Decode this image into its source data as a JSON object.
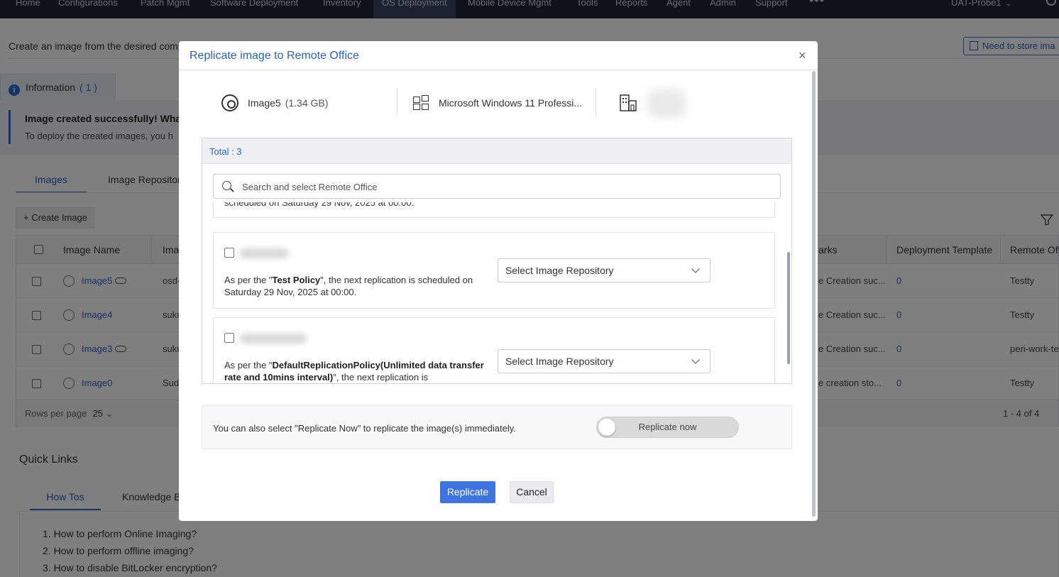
{
  "nav": {
    "items": [
      "Home",
      "Configurations",
      "Patch Mgmt",
      "Software Deployment",
      "Inventory",
      "OS Deployment",
      "Mobile Device Mgmt",
      "Tools",
      "Reports",
      "Agent",
      "Admin",
      "Support"
    ],
    "more": "•••",
    "probe": "UAT-Probe1"
  },
  "page": {
    "description": "Create an image from the desired comp",
    "need_store": "Need to store ima",
    "info_tab": {
      "label": "Information",
      "count": "( 1 )"
    },
    "info_title": "Image created successfully! Wha",
    "info_text": "To deploy the created images, you h",
    "tabs": [
      "Images",
      "Image Repositor"
    ],
    "create_image": "Create Image",
    "table": {
      "headers": {
        "name": "Image Name",
        "type": "Ima",
        "remarks": "arks",
        "template": "Deployment Template",
        "remote": "Remote Off"
      },
      "rows": [
        {
          "name": "Image5",
          "type": "osd-",
          "remarks": "e Creation suc...",
          "template": "0",
          "remote": "Testty",
          "cloud": true
        },
        {
          "name": "Image4",
          "type": "suku",
          "remarks": "e Creation suc...",
          "template": "0",
          "remote": "Testty",
          "cloud": false
        },
        {
          "name": "Image3",
          "type": "suku",
          "remarks": "e Creation suc...",
          "template": "0",
          "remote": "peri-work-te",
          "cloud": true
        },
        {
          "name": "Image0",
          "type": "Suda",
          "remarks": "e creation sto...",
          "template": "0",
          "remote": "Testty",
          "cloud": false
        }
      ],
      "rows_per_page_label": "Rows per page",
      "rows_per_page": "25",
      "pagination": "1 - 4 of 4"
    },
    "quick_links": {
      "title": "Quick Links",
      "tabs": [
        "How Tos",
        "Knowledge B"
      ],
      "items": [
        "1. How to perform Online Imaging?",
        "2. How to perform offline imaging?",
        "3. How to disable BitLocker encryption?"
      ]
    }
  },
  "modal": {
    "title": "Replicate image to Remote Office",
    "close": "×",
    "image_name": "Image5",
    "image_size": "(1.34 GB)",
    "os": "Microsoft Windows 11 Professi...",
    "total": "Total : 3",
    "search_placeholder": "Search and select Remote Office",
    "partial_text": "scheduled on Saturday 29 Nov, 2025 at 00:00.",
    "offices": [
      {
        "pre": "As per the \"",
        "policy": "Test Policy",
        "post": "\", the next replication is scheduled on Saturday 29 Nov, 2025 at 00:00.",
        "select": "Select Image Repository"
      },
      {
        "pre": "As per the \"",
        "policy": "DefaultReplicationPolicy(Unlimited data transfer rate and 10mins interval)",
        "post": "\", the next replication is",
        "select": "Select Image Repository"
      }
    ],
    "replicate_now_text": "You can also select \"Replicate Now\" to replicate the image(s) immediately.",
    "toggle_label": "Replicate now",
    "replicate_button": "Replicate",
    "cancel_button": "Cancel"
  },
  "colors": {
    "accent": "#2a61c8",
    "primary_button": "#3f74e0",
    "nav_bg": "#1e2535"
  }
}
